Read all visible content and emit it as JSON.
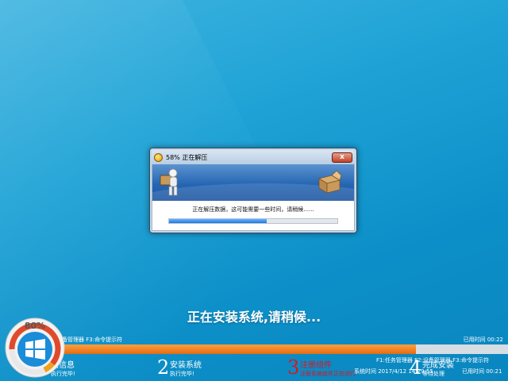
{
  "dialog": {
    "title": "58% 正在解压",
    "close_label": "x",
    "status": "正在解压数据，这可能需要一些时间，请稍候......",
    "progress": 0.58
  },
  "main_message": "正在安装系统,请稍候...",
  "top_status": {
    "f_keys": "备管理器  F3:命令提示符",
    "elapsed": "已用时间 00:22"
  },
  "bottom_status": {
    "f1_f2": "F1:任务管理器  F2:设备管理器  F3:命令提示符",
    "sys_time": "系统时间 2017/4/12 14:29:55",
    "elapsed": "已用时间 00:21"
  },
  "overall_progress": 0.8,
  "logo_percent": "80%",
  "steps": [
    {
      "num": "1",
      "title": "始信息",
      "sub": "执行完毕!"
    },
    {
      "num": "2",
      "title": "安装系统",
      "sub": "执行完毕!"
    },
    {
      "num": "3",
      "title": "注册组件",
      "sub": "注册系统组件正在进行"
    },
    {
      "num": "4",
      "title": "完成安装",
      "sub": "等待处理"
    }
  ],
  "colors": {
    "accent_orange": "#e56b10",
    "active_step": "#e0141c",
    "progress_blue": "#1e78e0"
  }
}
